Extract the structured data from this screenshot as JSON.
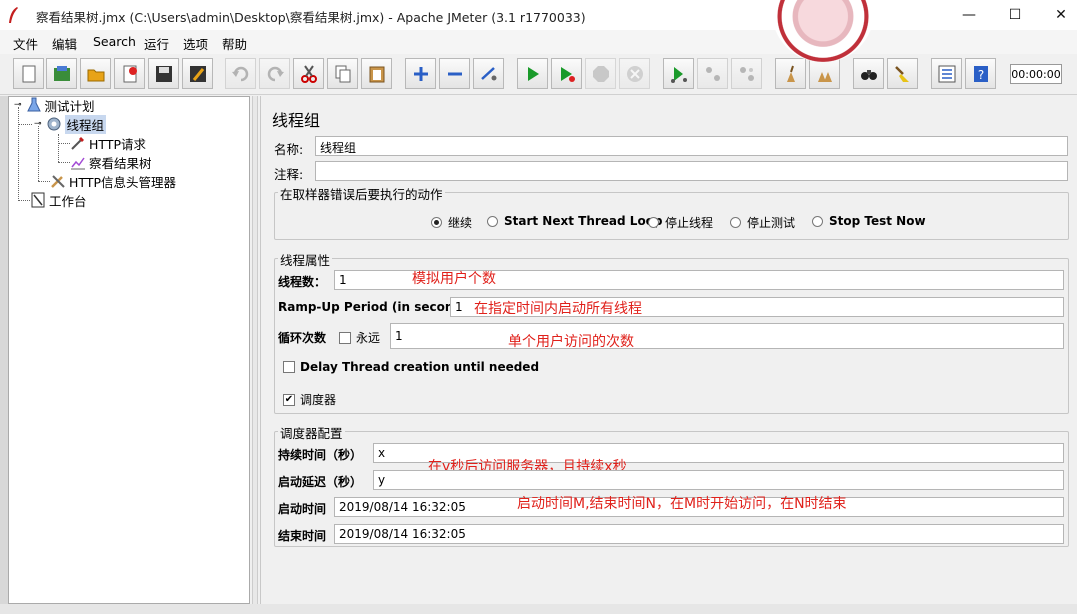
{
  "window": {
    "title": "察看结果树.jmx (C:\\Users\\admin\\Desktop\\察看结果树.jmx) - Apache JMeter (3.1 r1770033)",
    "minimize": "—",
    "maximize": "☐",
    "close": "✕"
  },
  "menu": [
    "文件",
    "编辑",
    "Search",
    "运行",
    "选项",
    "帮助"
  ],
  "toolbar": {
    "timer": "00:00:00",
    "icons": [
      "new-icon",
      "templates-icon",
      "open-icon",
      "close-file-icon",
      "save-icon",
      "save-as-icon",
      "undo-icon",
      "redo-icon",
      "cut-icon",
      "copy-icon",
      "paste-icon",
      "expand-icon",
      "collapse-icon",
      "toggle-icon",
      "start-icon",
      "start-no-pause-icon",
      "stop-icon",
      "shutdown-icon",
      "remote-start-icon",
      "remote-stop-icon",
      "remote-shutdown-icon",
      "clear-icon",
      "clear-all-icon",
      "search-icon",
      "reset-search-icon",
      "function-helper-icon",
      "help-icon"
    ]
  },
  "tree": {
    "items": [
      {
        "label": "测试计划"
      },
      {
        "label": "线程组"
      },
      {
        "label": "HTTP请求"
      },
      {
        "label": "察看结果树"
      },
      {
        "label": "HTTP信息头管理器"
      },
      {
        "label": "工作台"
      }
    ]
  },
  "panel": {
    "title": "线程组",
    "name_label": "名称:",
    "name_value": "线程组",
    "comment_label": "注释:",
    "comment_value": "",
    "error_group_title": "在取样器错误后要执行的动作",
    "error_actions": [
      {
        "label": "继续",
        "selected": true
      },
      {
        "label": "Start Next Thread Loop",
        "selected": false
      },
      {
        "label": "停止线程",
        "selected": false
      },
      {
        "label": "停止测试",
        "selected": false
      },
      {
        "label": "Stop Test Now",
        "selected": false
      }
    ],
    "thread_group_title": "线程属性",
    "threads_label": "线程数：",
    "threads_value": "1",
    "rampup_label": "Ramp-Up Period (in seconds):",
    "rampup_value": "1",
    "loop_label": "循环次数",
    "forever_label": "永远",
    "forever_checked": false,
    "loop_value": "1",
    "delay_label": "Delay Thread creation until needed",
    "delay_checked": false,
    "scheduler_label": "调度器",
    "scheduler_checked": true,
    "scheduler_group_title": "调度器配置",
    "duration_label": "持续时间（秒）",
    "duration_value": "x",
    "startup_delay_label": "启动延迟（秒）",
    "startup_delay_value": "y",
    "start_time_label": "启动时间",
    "start_time_value": "2019/08/14 16:32:05",
    "end_time_label": "结束时间",
    "end_time_value": "2019/08/14 16:32:05"
  },
  "annotations": {
    "threads": "模拟用户个数",
    "rampup": "在指定时间内启动所有线程",
    "loop": "单个用户访问的次数",
    "duration": "在y秒后访问服务器，且持续x秒",
    "start_end": "启动时间M,结束时间N，在M时开始访问，在N时结束"
  },
  "colors": {
    "annotation": "#e0211b",
    "selected_tree": "#c8d8ef"
  }
}
